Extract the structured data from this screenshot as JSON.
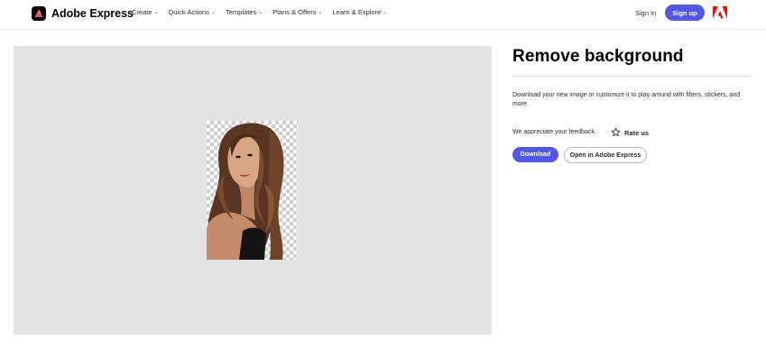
{
  "header": {
    "brand": "Adobe Express",
    "nav": [
      {
        "label": "Create"
      },
      {
        "label": "Quick Actions"
      },
      {
        "label": "Templates"
      },
      {
        "label": "Plans & Offers"
      },
      {
        "label": "Learn & Explore"
      }
    ],
    "sign_in": "Sign In",
    "sign_up": "Sign up"
  },
  "main": {
    "title": "Remove background",
    "description": "Download your new image or customize it to play around with filters, stickers, and more.",
    "feedback_text": "We appreciate your feedback.",
    "rate_label": "Rate us",
    "download_label": "Download",
    "open_label": "Open in Adobe Express"
  },
  "colors": {
    "accent": "#5258e4",
    "canvas": "#e3e3e3",
    "adobe_red": "#eb1000"
  },
  "icons": {
    "brand": "adobe-express-logo-icon",
    "nav_chevron": "chevron-down-icon",
    "adobe": "adobe-logo-icon",
    "rate": "star-icon"
  }
}
